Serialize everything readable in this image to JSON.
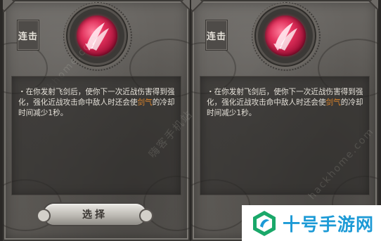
{
  "panels": [
    {
      "title": "连击",
      "description": {
        "before": "・在你发射飞剑后，使你下一次近战伤害得到强化，强化近战攻击命中敌人时还会使",
        "highlight": "剑气",
        "after": "的冷却时间减少1秒。"
      },
      "button_label": "选择"
    },
    {
      "title": "连击",
      "description": {
        "before": "・在你发射飞剑后，使你下一次近战伤害得到强化，强化近战攻击命中敌人时还会使",
        "highlight": "剑气",
        "after": "的冷却时间减少1秒。"
      }
    }
  ],
  "watermarks": [
    "嗨客手机站",
    "hackhome.com"
  ],
  "brand": {
    "name": "十号手游网",
    "logo": "shihao-logo-icon"
  },
  "colors": {
    "emblem": "#e1305b",
    "highlight": "#d9832c",
    "brand": "#1c9ad6"
  }
}
